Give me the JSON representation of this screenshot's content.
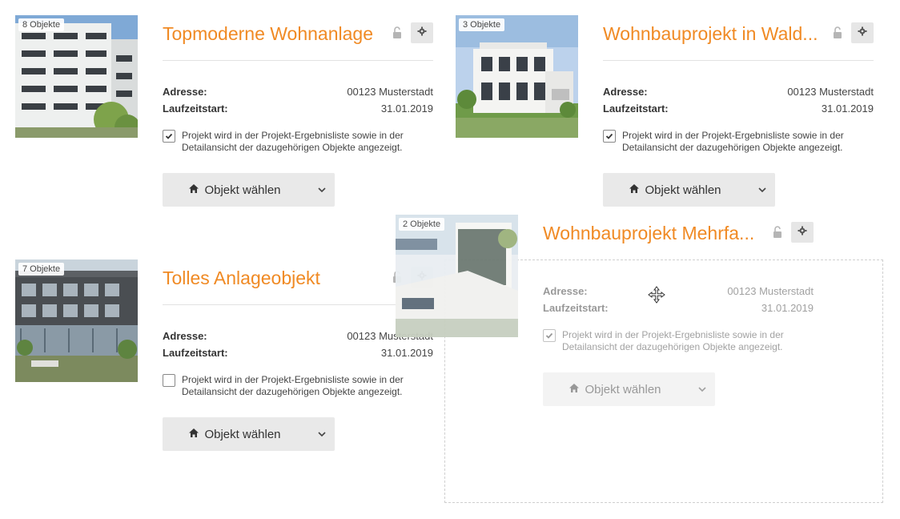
{
  "cards": [
    {
      "badge": "8 Objekte",
      "title": "Topmoderne Wohnanlage",
      "address_label": "Adresse:",
      "address_value": "00123 Musterstadt",
      "start_label": "Laufzeitstart:",
      "start_value": "31.01.2019",
      "check_text": "Projekt wird in der Projekt-Ergebnisliste sowie in der Detailansicht der dazugehörigen Objekte angezeigt.",
      "checked": true,
      "button_label": "Objekt wählen"
    },
    {
      "badge": "3 Objekte",
      "title": "Wohnbauprojekt in Wald...",
      "address_label": "Adresse:",
      "address_value": "00123 Musterstadt",
      "start_label": "Laufzeitstart:",
      "start_value": "31.01.2019",
      "check_text": "Projekt wird in der Projekt-Ergebnisliste sowie in der Detailansicht der dazugehörigen Objekte angezeigt.",
      "checked": true,
      "button_label": "Objekt wählen"
    },
    {
      "badge": "7 Objekte",
      "title": "Tolles Anlageobjekt",
      "address_label": "Adresse:",
      "address_value": "00123 Musterstadt",
      "start_label": "Laufzeitstart:",
      "start_value": "31.01.2019",
      "check_text": "Projekt wird in der Projekt-Ergebnisliste sowie in der Detailansicht der dazugehörigen Objekte angezeigt.",
      "checked": false,
      "button_label": "Objekt wählen"
    },
    {
      "badge": "2 Objekte",
      "title": "Wohnbauprojekt Mehrfa...",
      "address_label": "Adresse:",
      "address_value": "00123 Musterstadt",
      "start_label": "Laufzeitstart:",
      "start_value": "31.01.2019",
      "check_text": "Projekt wird in der Projekt-Ergebnisliste sowie in der Detailansicht der dazugehörigen Objekte angezeigt.",
      "checked": true,
      "button_label": "Objekt wählen"
    }
  ],
  "icons": {
    "lock": "unlock-icon",
    "gear": "gear-icon",
    "home": "home-icon",
    "chevron": "chevron-down-icon",
    "checkmark": "checkmark-icon",
    "move": "move-cursor-icon"
  },
  "colors": {
    "accent": "#f08a24",
    "button_bg": "#e9e9e9",
    "dropzone_border": "#cfcfcf"
  }
}
